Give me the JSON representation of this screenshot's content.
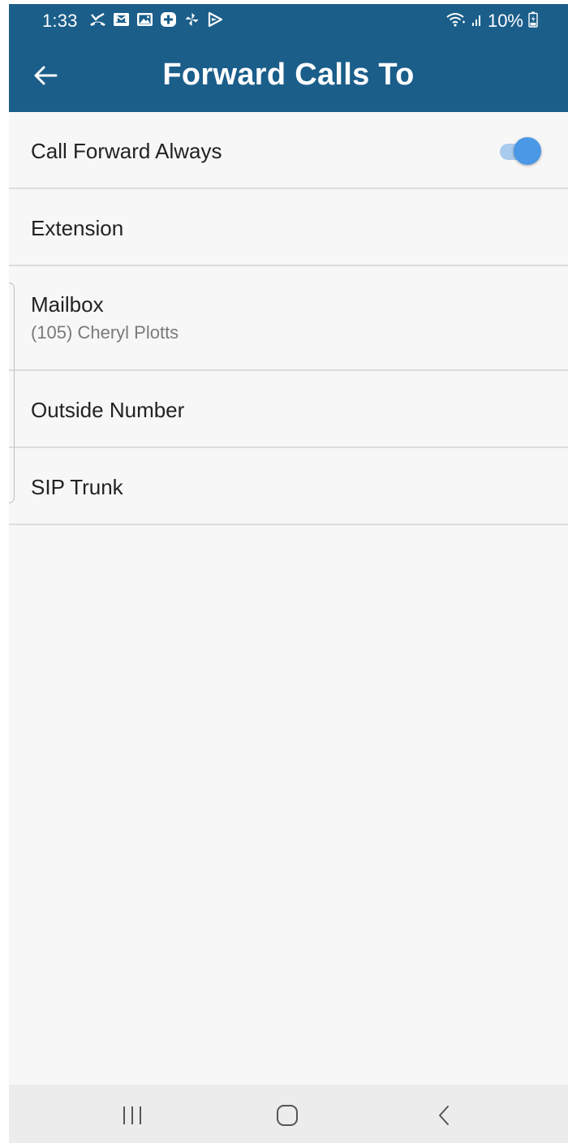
{
  "status_bar": {
    "time": "1:33",
    "battery": "10%",
    "notification_icons": [
      "missed-call-icon",
      "mail-icon",
      "gallery-icon",
      "plus-app-icon",
      "pinwheel-icon",
      "play-store-icon"
    ]
  },
  "app_bar": {
    "title": "Forward Calls To",
    "back_icon": "arrow-left-icon"
  },
  "list": {
    "items": [
      {
        "label": "Call Forward Always",
        "toggle_on": true
      },
      {
        "label": "Extension"
      },
      {
        "label": "Mailbox",
        "sublabel": "(105) Cheryl  Plotts"
      },
      {
        "label": "Outside Number"
      },
      {
        "label": "SIP Trunk"
      }
    ]
  },
  "colors": {
    "header": "#1b5e8a",
    "toggle_accent": "#4a98e6",
    "background": "#f7f7f7"
  },
  "nav_bar": {
    "icons": [
      "recent-apps-icon",
      "home-icon",
      "back-chevron-icon"
    ]
  }
}
